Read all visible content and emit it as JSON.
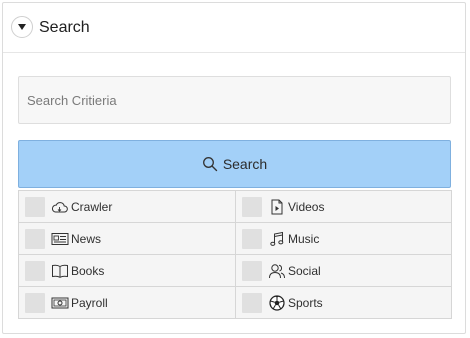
{
  "panel": {
    "title": "Search",
    "toggle_icon": "caret-down-icon"
  },
  "search": {
    "placeholder": "Search Critieria",
    "value": "",
    "button_label": "Search",
    "button_color": "#a3d0f8"
  },
  "categories": [
    {
      "label": "Crawler",
      "icon": "cloud-icon",
      "checked": false
    },
    {
      "label": "Videos",
      "icon": "video-file-icon",
      "checked": false
    },
    {
      "label": "News",
      "icon": "newspaper-icon",
      "checked": false
    },
    {
      "label": "Music",
      "icon": "music-note-icon",
      "checked": false
    },
    {
      "label": "Books",
      "icon": "book-icon",
      "checked": false
    },
    {
      "label": "Social",
      "icon": "users-icon",
      "checked": false
    },
    {
      "label": "Payroll",
      "icon": "money-icon",
      "checked": false
    },
    {
      "label": "Sports",
      "icon": "soccer-ball-icon",
      "checked": false
    }
  ]
}
